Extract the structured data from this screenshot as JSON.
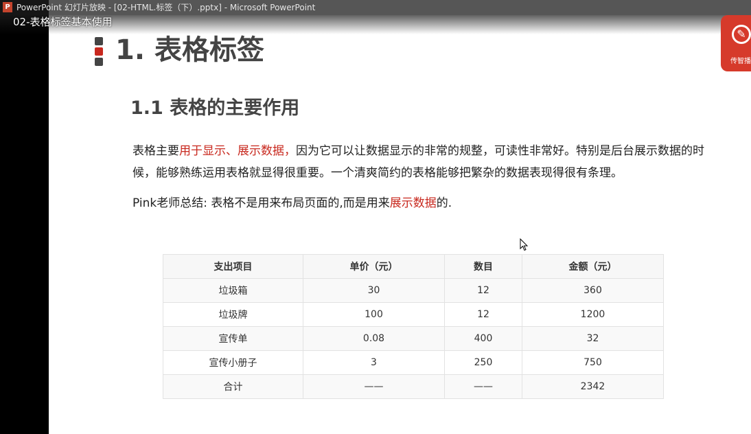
{
  "window": {
    "title": "PowerPoint 幻灯片放映 - [02-HTML.标签（下）.pptx] - Microsoft PowerPoint",
    "app_icon_letter": "P"
  },
  "video": {
    "title": "02-表格标签基本使用"
  },
  "logo": {
    "text": "传智播",
    "icon": "brand-logo-icon",
    "color": "#d63a2b"
  },
  "slide": {
    "heading1": "1. 表格标签",
    "heading2": "1.1 表格的主要作用",
    "para1_pre": "表格主要",
    "para1_hl": "用于显示、展示数据，",
    "para1_post": "因为它可以让数据显示的非常的规整，可读性非常好。特别是后台展示数据的时候，能够熟练运用表格就显得很重要。一个清爽简约的表格能够把繁杂的数据表现得很有条理。",
    "para2_pre": "Pink老师总结: 表格不是用来布局页面的,而是用来",
    "para2_hl": "展示数据",
    "para2_post": "的.",
    "accent_color": "#c8281e"
  },
  "table": {
    "headers": [
      "支出项目",
      "单价（元）",
      "数目",
      "金额（元）"
    ],
    "rows": [
      [
        "垃圾箱",
        "30",
        "12",
        "360"
      ],
      [
        "垃圾牌",
        "100",
        "12",
        "1200"
      ],
      [
        "宣传单",
        "0.08",
        "400",
        "32"
      ],
      [
        "宣传小册子",
        "3",
        "250",
        "750"
      ],
      [
        "合计",
        "——",
        "——",
        "2342"
      ]
    ]
  }
}
